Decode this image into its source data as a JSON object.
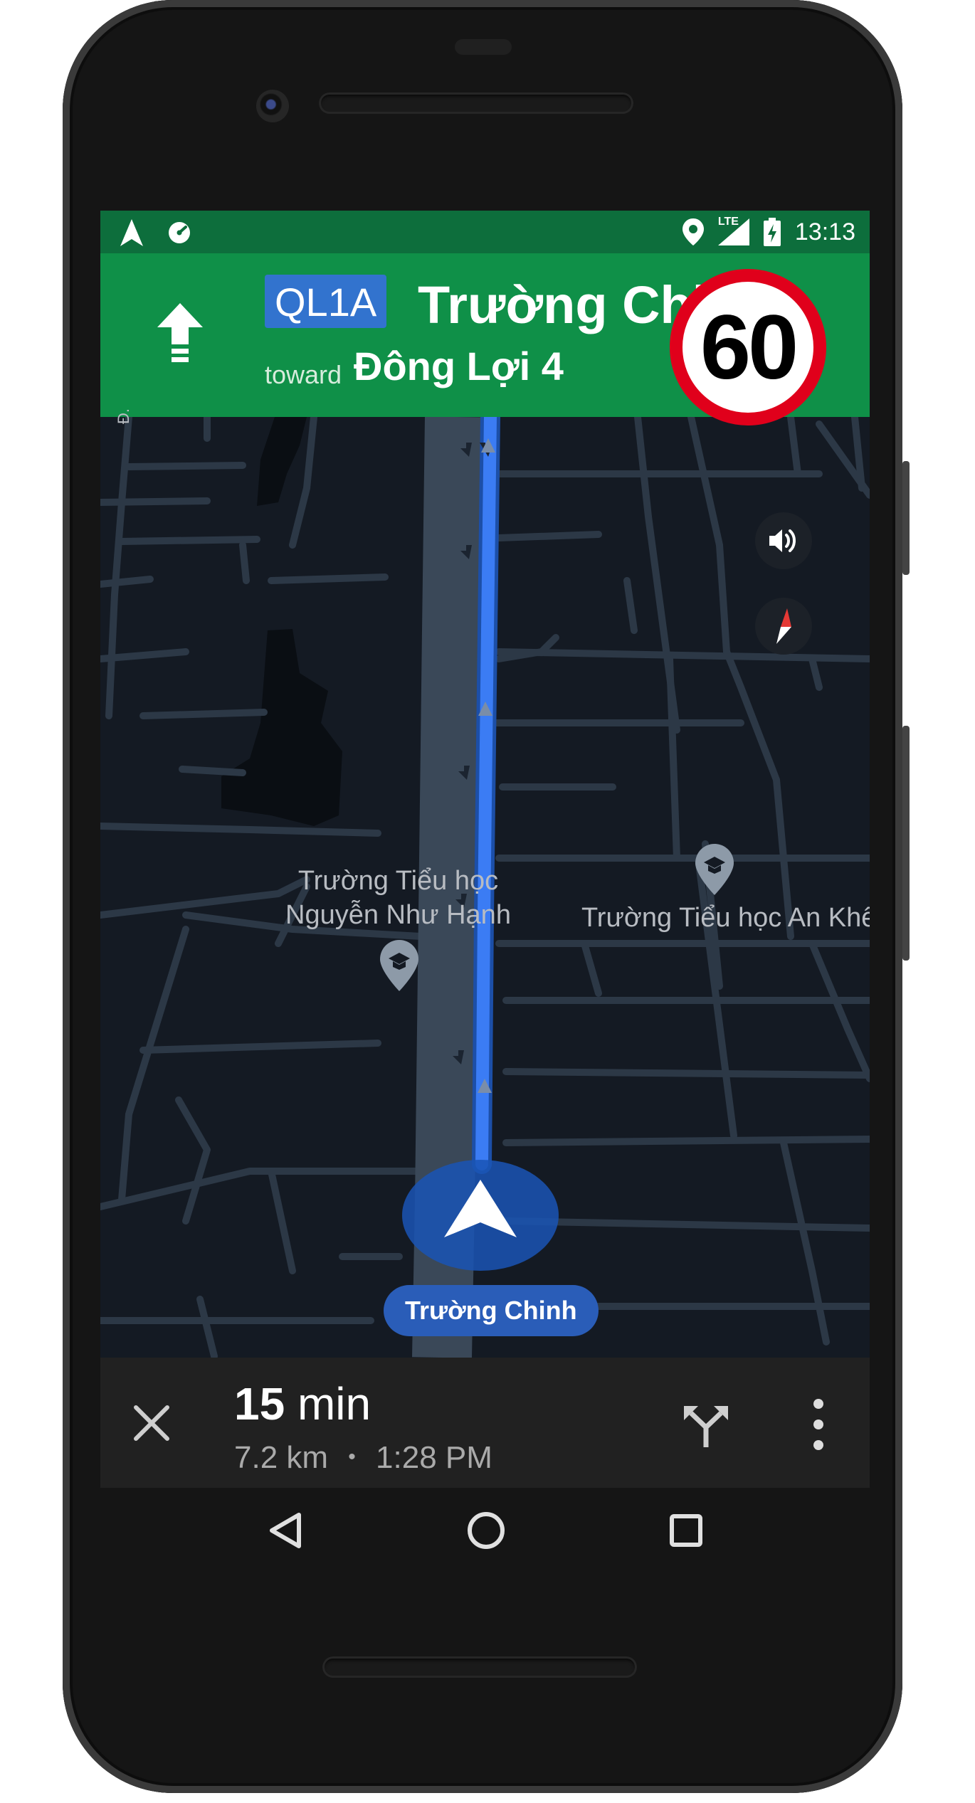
{
  "status_bar": {
    "left_icons": [
      "navigation-arrow-icon",
      "speedometer-icon"
    ],
    "right_icons": [
      "location-pin-icon",
      "lte-signal-icon",
      "battery-charging-icon"
    ],
    "lte_label": "LTE",
    "time": "13:13"
  },
  "nav_header": {
    "maneuver_icon": "straight-arrow-icon",
    "route_badge": "QL1A",
    "street": "Trường Chinh",
    "toward_label": "toward",
    "destination": "Đông Lợi 4",
    "background_color": "#0f9048",
    "badge_color": "#3273ce"
  },
  "speed_limit": {
    "value": "60",
    "ring_color": "#e0001b"
  },
  "map": {
    "side_buttons": [
      "sound-icon",
      "compass-icon"
    ],
    "place_labels": [
      {
        "line1": "Trường Tiểu học",
        "line2": "Nguyễn Như Hạnh",
        "icon": "school-pin-icon"
      },
      {
        "line1": "Trường Tiểu học An Khê",
        "icon": "school-pin-icon"
      }
    ],
    "road_edge_label": "Đ.",
    "current_street": "Trường Chinh",
    "route_color": "#3b7cf4"
  },
  "bottom_bar": {
    "eta_value": "15",
    "eta_unit": "min",
    "distance": "7.2 km",
    "separator": "•",
    "arrival_time": "1:28 PM",
    "buttons": [
      "close-icon",
      "alternate-routes-icon",
      "more-vert-icon"
    ]
  },
  "system_nav": [
    "back-icon",
    "home-icon",
    "recents-icon"
  ]
}
